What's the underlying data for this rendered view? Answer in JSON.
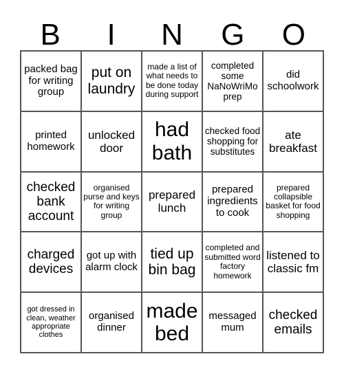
{
  "header": [
    "B",
    "I",
    "N",
    "G",
    "O"
  ],
  "cells": [
    "packed bag for writing group",
    "put on laundry",
    "made a list of what needs to be done today during support",
    "completed some NaNoWriMo prep",
    "did schoolwork",
    "printed homework",
    "unlocked door",
    "had bath",
    "checked food shopping for substitutes",
    "ate breakfast",
    "checked bank account",
    "organised purse and keys for writing group",
    "prepared lunch",
    "prepared ingredients to cook",
    "prepared collapsible basket for food shopping",
    "charged devices",
    "got up with alarm clock",
    "tied up bin bag",
    "completed and submitted word factory homework",
    "listened to classic fm",
    "got dressed in clean, weather appropriate clothes",
    "organised dinner",
    "made bed",
    "messaged mum",
    "checked emails"
  ]
}
